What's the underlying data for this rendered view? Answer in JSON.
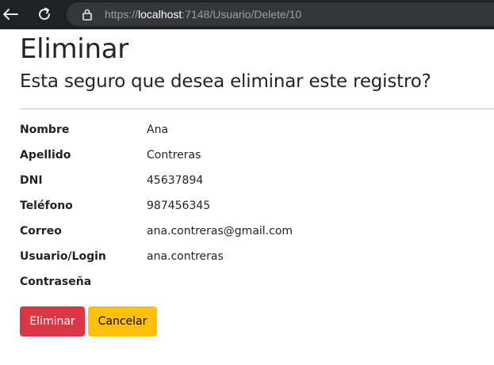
{
  "browser": {
    "url_prefix": "https://",
    "url_host": "localhost",
    "url_path": ":7148/Usuario/Delete/10"
  },
  "page": {
    "title": "Eliminar",
    "subtitle": "Esta seguro que desea eliminar este registro?"
  },
  "fields": [
    {
      "label": "Nombre",
      "value": "Ana"
    },
    {
      "label": "Apellido",
      "value": "Contreras"
    },
    {
      "label": "DNI",
      "value": "45637894"
    },
    {
      "label": "Teléfono",
      "value": "987456345"
    },
    {
      "label": "Correo",
      "value": "ana.contreras@gmail.com"
    },
    {
      "label": "Usuario/Login",
      "value": "ana.contreras"
    },
    {
      "label": "Contraseña",
      "value": ""
    }
  ],
  "actions": {
    "delete_label": "Eliminar",
    "cancel_label": "Cancelar"
  },
  "colors": {
    "delete": "#dc3545",
    "cancel": "#ffc107",
    "chrome": "#202124"
  }
}
